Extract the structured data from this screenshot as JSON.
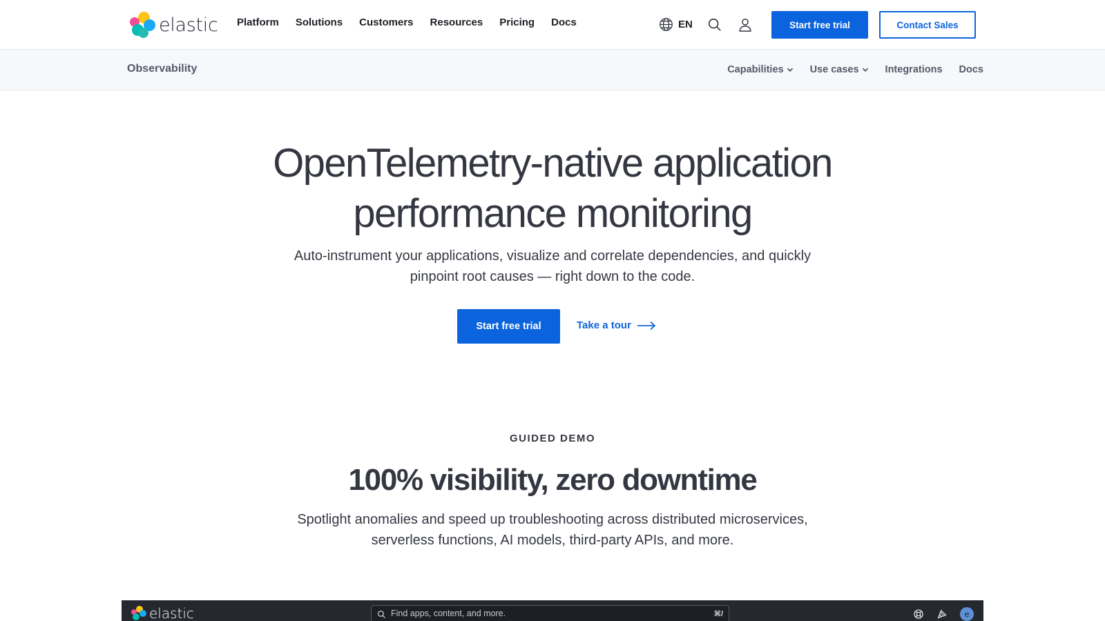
{
  "topnav": {
    "logo_text": "elastic",
    "menu": [
      "Platform",
      "Solutions",
      "Customers",
      "Resources",
      "Pricing",
      "Docs"
    ],
    "language": "EN",
    "start_trial_label": "Start free trial",
    "contact_sales_label": "Contact Sales"
  },
  "subnav": {
    "title": "Observability",
    "items": [
      {
        "label": "Capabilities",
        "dropdown": true
      },
      {
        "label": "Use cases",
        "dropdown": true
      },
      {
        "label": "Integrations",
        "dropdown": false
      },
      {
        "label": "Docs",
        "dropdown": false
      }
    ]
  },
  "hero": {
    "title_line1": "OpenTelemetry-native application",
    "title_line2": "performance monitoring",
    "subtitle_line1": "Auto-instrument your applications, visualize and correlate dependencies, and quickly",
    "subtitle_line2": "pinpoint root causes — right down to the code.",
    "cta_label": "Start free trial",
    "tour_label": "Take a tour"
  },
  "demo_section": {
    "eyebrow": "GUIDED DEMO",
    "title": "100% visibility, zero downtime",
    "subtitle_line1": "Spotlight anomalies and speed up troubleshooting across distributed microservices,",
    "subtitle_line2": "serverless functions, AI models, third-party APIs, and more."
  },
  "demo_app": {
    "logo_text": "elastic",
    "search_placeholder": "Find apps, content, and more.",
    "search_shortcut": "⌘/",
    "avatar_initial": "e"
  },
  "colors": {
    "accent": "#0b64dd",
    "text": "#343741",
    "subnav_bg": "#f7f8fc",
    "demo_bar_bg": "#25282f"
  }
}
